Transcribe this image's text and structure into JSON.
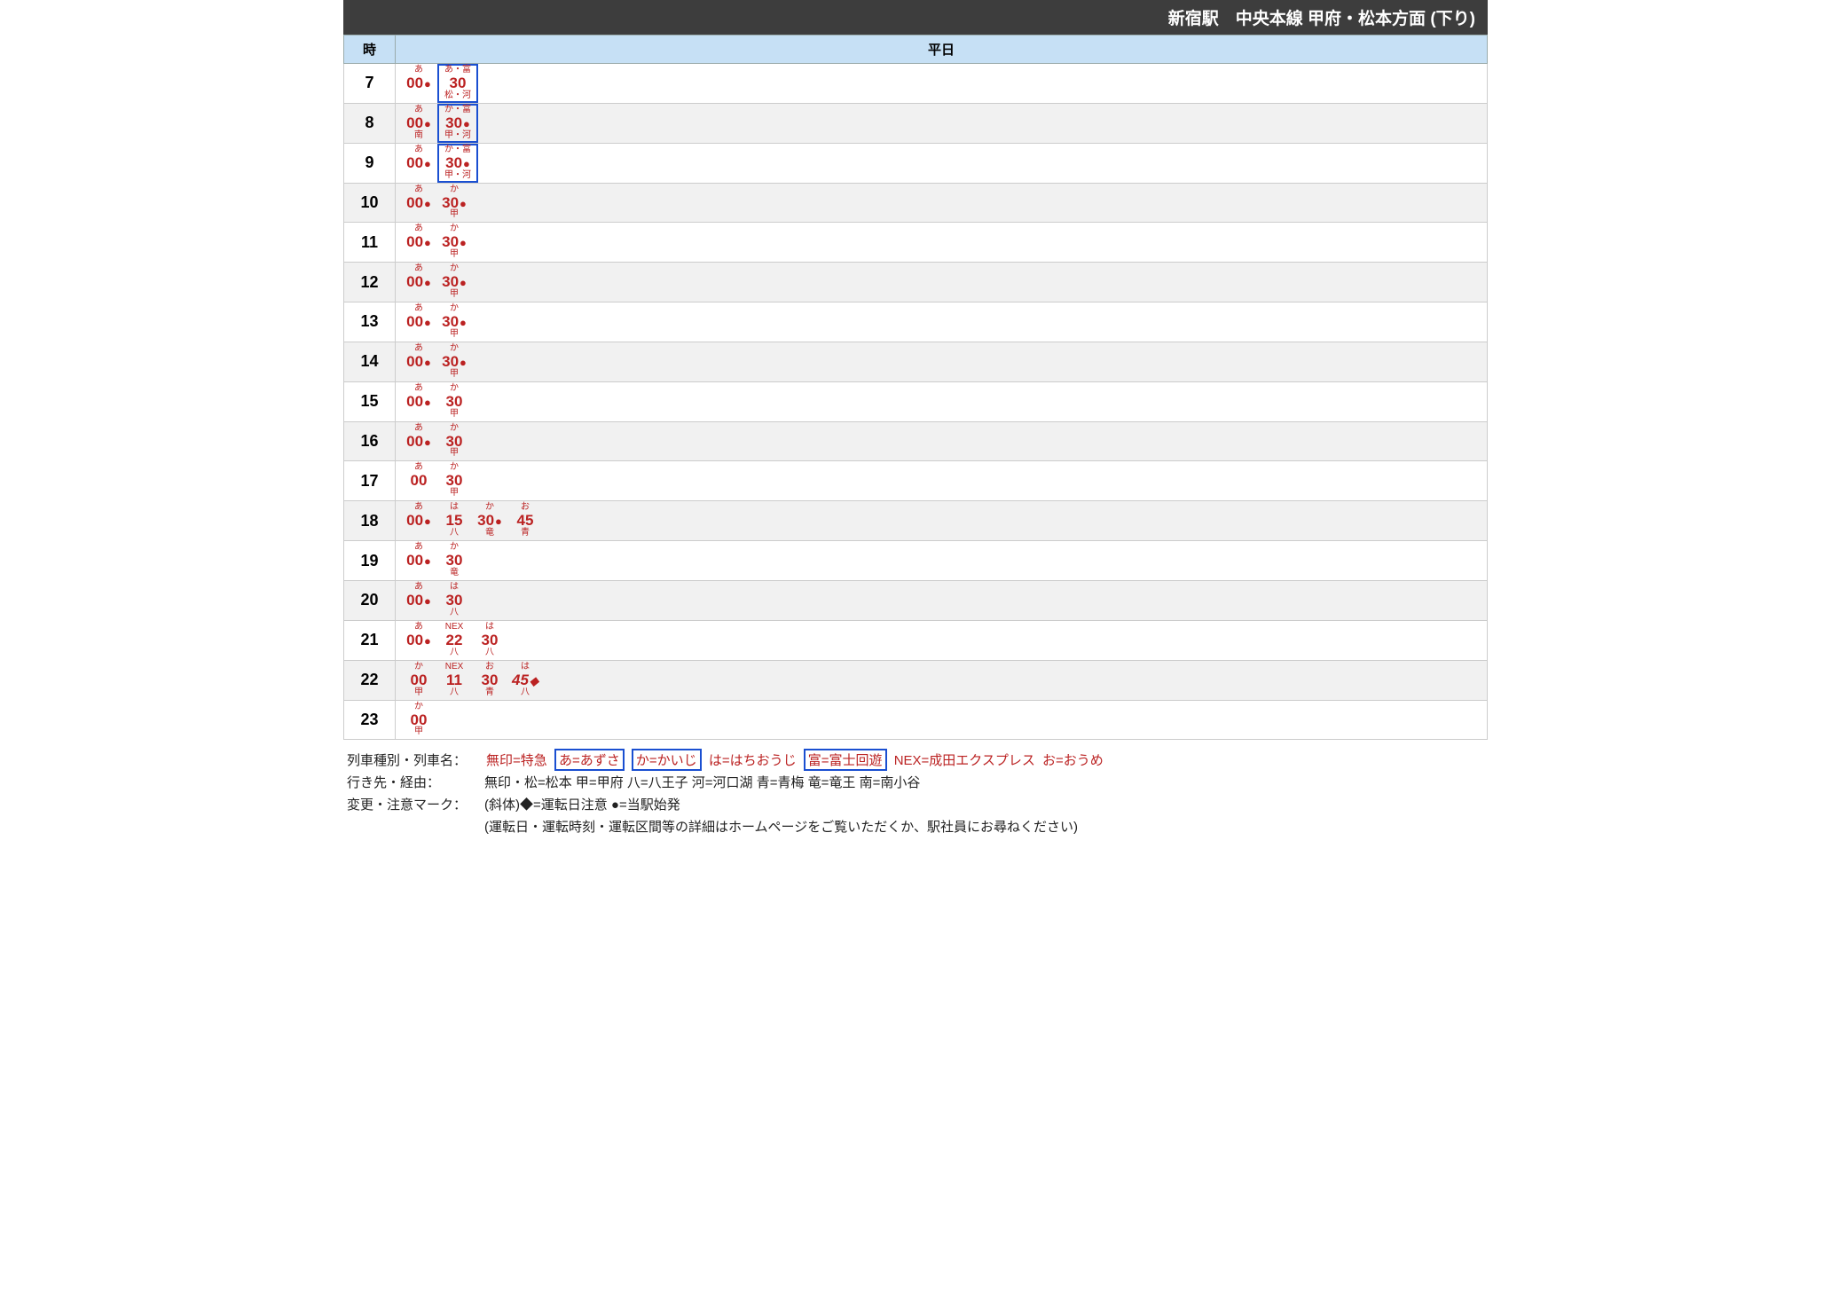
{
  "title": "新宿駅　中央本線 甲府・松本方面 (下り)",
  "columns": {
    "hour": "時",
    "day": "平日"
  },
  "rows": [
    {
      "hour": "7",
      "deps": [
        {
          "top": "あ",
          "min": "00",
          "dot": true,
          "bot": ""
        },
        {
          "top": "あ・富",
          "min": "30",
          "dot": false,
          "bot": "松・河",
          "boxed": true
        }
      ]
    },
    {
      "hour": "8",
      "deps": [
        {
          "top": "あ",
          "min": "00",
          "dot": true,
          "bot": "南"
        },
        {
          "top": "か・富",
          "min": "30",
          "dot": true,
          "bot": "甲・河",
          "boxed": true
        }
      ]
    },
    {
      "hour": "9",
      "deps": [
        {
          "top": "あ",
          "min": "00",
          "dot": true,
          "bot": ""
        },
        {
          "top": "か・富",
          "min": "30",
          "dot": true,
          "bot": "甲・河",
          "boxed": true
        }
      ]
    },
    {
      "hour": "10",
      "deps": [
        {
          "top": "あ",
          "min": "00",
          "dot": true,
          "bot": ""
        },
        {
          "top": "か",
          "min": "30",
          "dot": true,
          "bot": "甲"
        }
      ]
    },
    {
      "hour": "11",
      "deps": [
        {
          "top": "あ",
          "min": "00",
          "dot": true,
          "bot": ""
        },
        {
          "top": "か",
          "min": "30",
          "dot": true,
          "bot": "甲"
        }
      ]
    },
    {
      "hour": "12",
      "deps": [
        {
          "top": "あ",
          "min": "00",
          "dot": true,
          "bot": ""
        },
        {
          "top": "か",
          "min": "30",
          "dot": true,
          "bot": "甲"
        }
      ]
    },
    {
      "hour": "13",
      "deps": [
        {
          "top": "あ",
          "min": "00",
          "dot": true,
          "bot": ""
        },
        {
          "top": "か",
          "min": "30",
          "dot": true,
          "bot": "甲"
        }
      ]
    },
    {
      "hour": "14",
      "deps": [
        {
          "top": "あ",
          "min": "00",
          "dot": true,
          "bot": ""
        },
        {
          "top": "か",
          "min": "30",
          "dot": true,
          "bot": "甲"
        }
      ]
    },
    {
      "hour": "15",
      "deps": [
        {
          "top": "あ",
          "min": "00",
          "dot": true,
          "bot": ""
        },
        {
          "top": "か",
          "min": "30",
          "dot": false,
          "bot": "甲"
        }
      ]
    },
    {
      "hour": "16",
      "deps": [
        {
          "top": "あ",
          "min": "00",
          "dot": true,
          "bot": ""
        },
        {
          "top": "か",
          "min": "30",
          "dot": false,
          "bot": "甲"
        }
      ]
    },
    {
      "hour": "17",
      "deps": [
        {
          "top": "あ",
          "min": "00",
          "dot": false,
          "bot": ""
        },
        {
          "top": "か",
          "min": "30",
          "dot": false,
          "bot": "甲"
        }
      ]
    },
    {
      "hour": "18",
      "deps": [
        {
          "top": "あ",
          "min": "00",
          "dot": true,
          "bot": ""
        },
        {
          "top": "は",
          "min": "15",
          "dot": false,
          "bot": "八"
        },
        {
          "top": "か",
          "min": "30",
          "dot": true,
          "bot": "竜"
        },
        {
          "top": "お",
          "min": "45",
          "dot": false,
          "bot": "青"
        }
      ]
    },
    {
      "hour": "19",
      "deps": [
        {
          "top": "あ",
          "min": "00",
          "dot": true,
          "bot": ""
        },
        {
          "top": "か",
          "min": "30",
          "dot": false,
          "bot": "竜"
        }
      ]
    },
    {
      "hour": "20",
      "deps": [
        {
          "top": "あ",
          "min": "00",
          "dot": true,
          "bot": ""
        },
        {
          "top": "は",
          "min": "30",
          "dot": false,
          "bot": "八"
        }
      ]
    },
    {
      "hour": "21",
      "deps": [
        {
          "top": "あ",
          "min": "00",
          "dot": true,
          "bot": ""
        },
        {
          "top": "NEX",
          "min": "22",
          "dot": false,
          "bot": "八"
        },
        {
          "top": "は",
          "min": "30",
          "dot": false,
          "bot": "八"
        }
      ]
    },
    {
      "hour": "22",
      "deps": [
        {
          "top": "か",
          "min": "00",
          "dot": false,
          "bot": "甲"
        },
        {
          "top": "NEX",
          "min": "11",
          "dot": false,
          "bot": "八"
        },
        {
          "top": "お",
          "min": "30",
          "dot": false,
          "bot": "青"
        },
        {
          "top": "は",
          "min": "45",
          "dot": false,
          "bot": "八",
          "italic": true,
          "diamond": true
        }
      ]
    },
    {
      "hour": "23",
      "deps": [
        {
          "top": "か",
          "min": "00",
          "dot": false,
          "bot": "甲"
        }
      ]
    }
  ],
  "legend": {
    "trainTypeLabel": "列車種別・列車名：",
    "trainTypeItems": [
      {
        "text": "無印=特急",
        "boxed": false
      },
      {
        "text": "あ=あずさ",
        "boxed": true
      },
      {
        "text": "か=かいじ",
        "boxed": true
      },
      {
        "text": "は=はちおうじ",
        "boxed": false
      },
      {
        "text": "富=富士回遊",
        "boxed": true
      },
      {
        "text": "NEX=成田エクスプレス",
        "boxed": false
      },
      {
        "text": "お=おうめ",
        "boxed": false
      }
    ],
    "destLabel": "行き先・経由：",
    "destText": "無印・松=松本 甲=甲府 八=八王子 河=河口湖 青=青梅 竜=竜王 南=南小谷",
    "markLabel": "変更・注意マーク：",
    "markText": "(斜体)◆=運転日注意 ●=当駅始発",
    "note": "(運転日・運転時刻・運転区間等の詳細はホームページをご覧いただくか、駅社員にお尋ねください)"
  }
}
